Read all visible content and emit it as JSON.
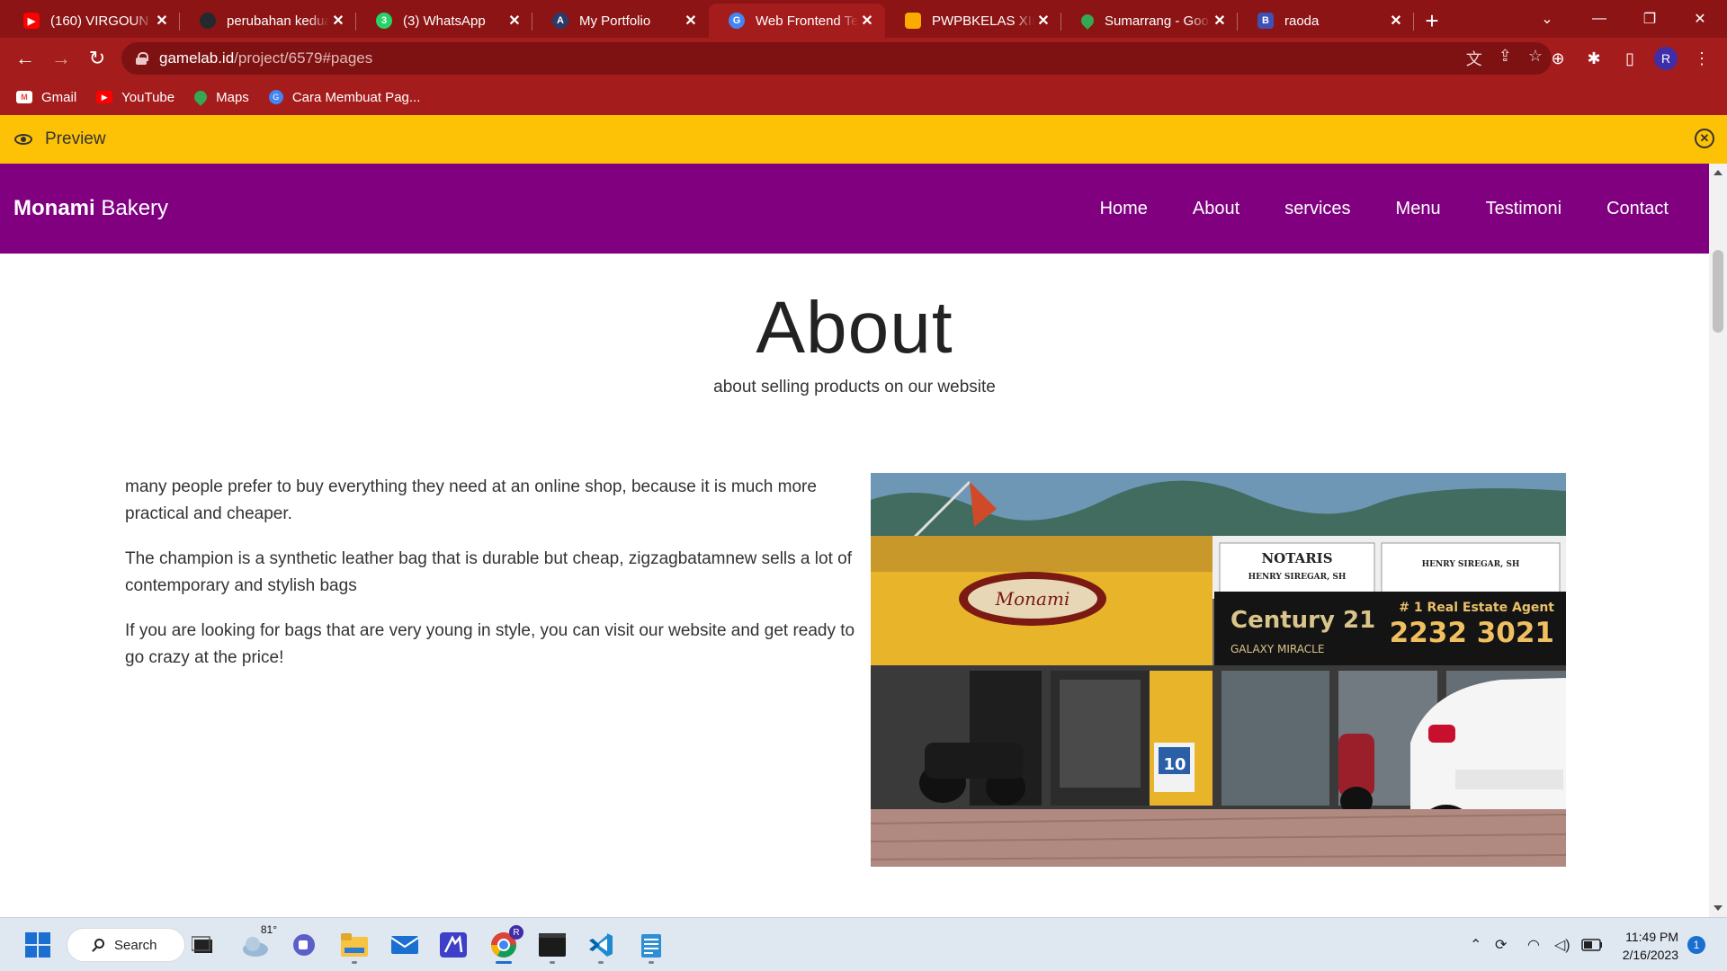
{
  "browser": {
    "tabs": [
      {
        "title": "(160) VIRGOUN -",
        "icon": "youtube-icon",
        "color": "#ff0000"
      },
      {
        "title": "perubahan kedua",
        "icon": "github-icon",
        "color": "#24292e"
      },
      {
        "title": "(3) WhatsApp",
        "icon": "whatsapp-icon",
        "color": "#25d366",
        "badge": "3"
      },
      {
        "title": "My Portfolio",
        "icon": "portfolio-icon",
        "color": "#2b3a67"
      },
      {
        "title": "Web Frontend Te",
        "icon": "gamelab-icon",
        "color": "#4285f4",
        "active": true
      },
      {
        "title": "PWPBKELAS XII R",
        "icon": "classroom-icon",
        "color": "#f9ab00"
      },
      {
        "title": "Sumarrang - Goo",
        "icon": "maps-icon",
        "color": "#34a853"
      },
      {
        "title": "raoda",
        "icon": "blogger-b-icon",
        "color": "#3f51b5",
        "letter": "B"
      }
    ],
    "new_tab": "+",
    "url": {
      "host": "gamelab.id",
      "path": "/project/6579#pages"
    },
    "profile_initial": "R",
    "bookmarks": [
      {
        "label": "Gmail",
        "icon": "gmail-icon",
        "color": "#ea4335"
      },
      {
        "label": "YouTube",
        "icon": "youtube-icon",
        "color": "#ff0000"
      },
      {
        "label": "Maps",
        "icon": "maps-icon",
        "color": "#34a853"
      },
      {
        "label": "Cara Membuat Pag...",
        "icon": "gamelab-icon",
        "color": "#4285f4"
      }
    ],
    "theme": {
      "tabstrip": "#8c1414",
      "toolbar": "#a51c1c"
    }
  },
  "preview_bar": {
    "label": "Preview",
    "color": "#fdc206"
  },
  "site": {
    "brand_bold": "Monami",
    "brand_rest": " Bakery",
    "nav": [
      "Home",
      "About",
      "services",
      "Menu",
      "Testimoni",
      "Contact"
    ],
    "nav_color": "#800080",
    "about": {
      "title": "About",
      "subtitle": "about selling products on our website",
      "paragraphs": [
        "many people prefer to buy everything they need at an online shop, because it is much more practical and cheaper.",
        "The champion is a synthetic leather bag that is durable but cheap, zigzagbatamnew sells a lot of contemporary and stylish bags",
        "If you are looking for bags that are very young in style, you can visit our website and get ready to go crazy at the price!"
      ],
      "photo": {
        "shop_sign": "Monami",
        "notaris_title": "NOTARIS",
        "notaris_name": "HENRY SIREGAR, SH",
        "century_brand": "Century 21",
        "century_sub": "GALAXY MIRACLE",
        "agent_tag": "# 1 Real Estate Agent",
        "phone": "2232 3021",
        "door_poster": "10"
      }
    }
  },
  "taskbar": {
    "search_label": "Search",
    "weather_temp": "81°",
    "time": "11:49 PM",
    "date": "2/16/2023",
    "notifications": "1"
  }
}
